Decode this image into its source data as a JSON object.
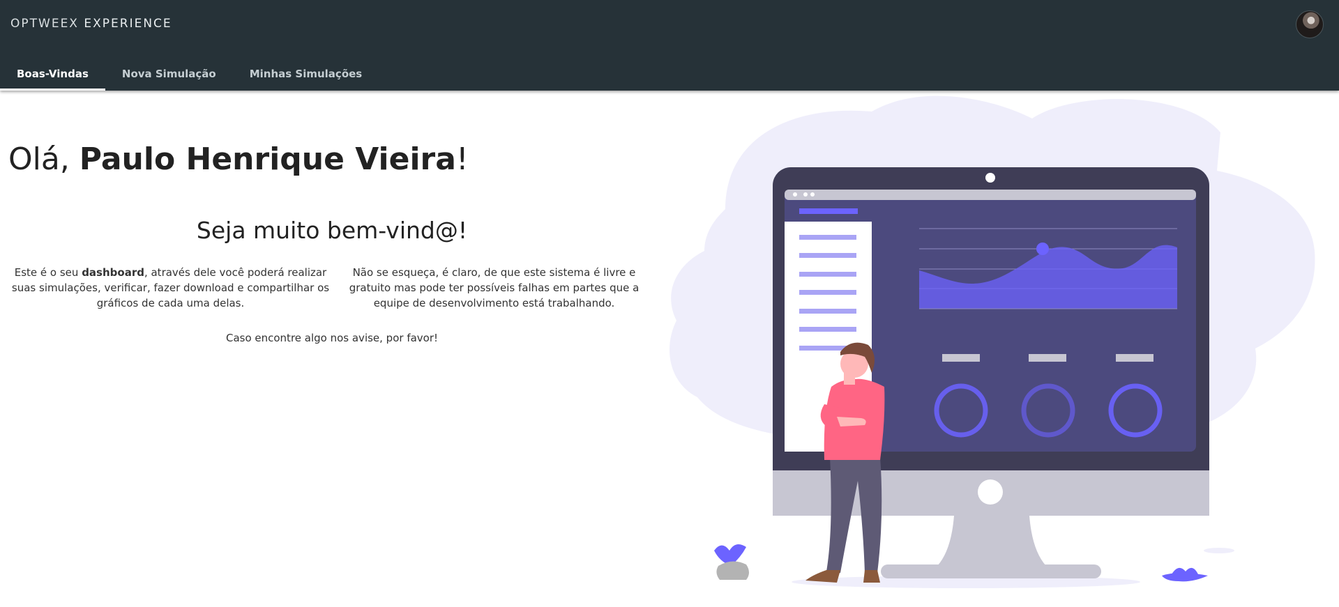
{
  "header": {
    "brand_light": "OPTWEEX",
    "brand_bold": "EXPERIENCE",
    "tabs": [
      {
        "label": "Boas-Vindas",
        "active": true
      },
      {
        "label": "Nova Simulação",
        "active": false
      },
      {
        "label": "Minhas Simulações",
        "active": false
      }
    ]
  },
  "main": {
    "greeting_prefix": "Olá, ",
    "user_name": "Paulo Henrique Vieira",
    "greeting_suffix": "!",
    "welcome_title": "Seja muito bem-vind@!",
    "para1_before": "Este é o seu ",
    "para1_bold": "dashboard",
    "para1_after": ", através dele você poderá realizar suas simulações, verificar, fazer download e compartilhar os gráficos de cada uma delas.",
    "para2": "Não se esqueça, é claro, de que este sistema é livre e gratuito mas pode ter possíveis falhas em partes que a equipe de desenvolvimento está trabalhando.",
    "footnote": "Caso encontre algo nos avise, por favor!"
  },
  "colors": {
    "header_bg": "#263238",
    "accent": "#6c63ff",
    "blob": "#efeefb",
    "shirt": "#ff6584"
  },
  "icons": [
    "avatar-image",
    "dashboard-illustration"
  ]
}
